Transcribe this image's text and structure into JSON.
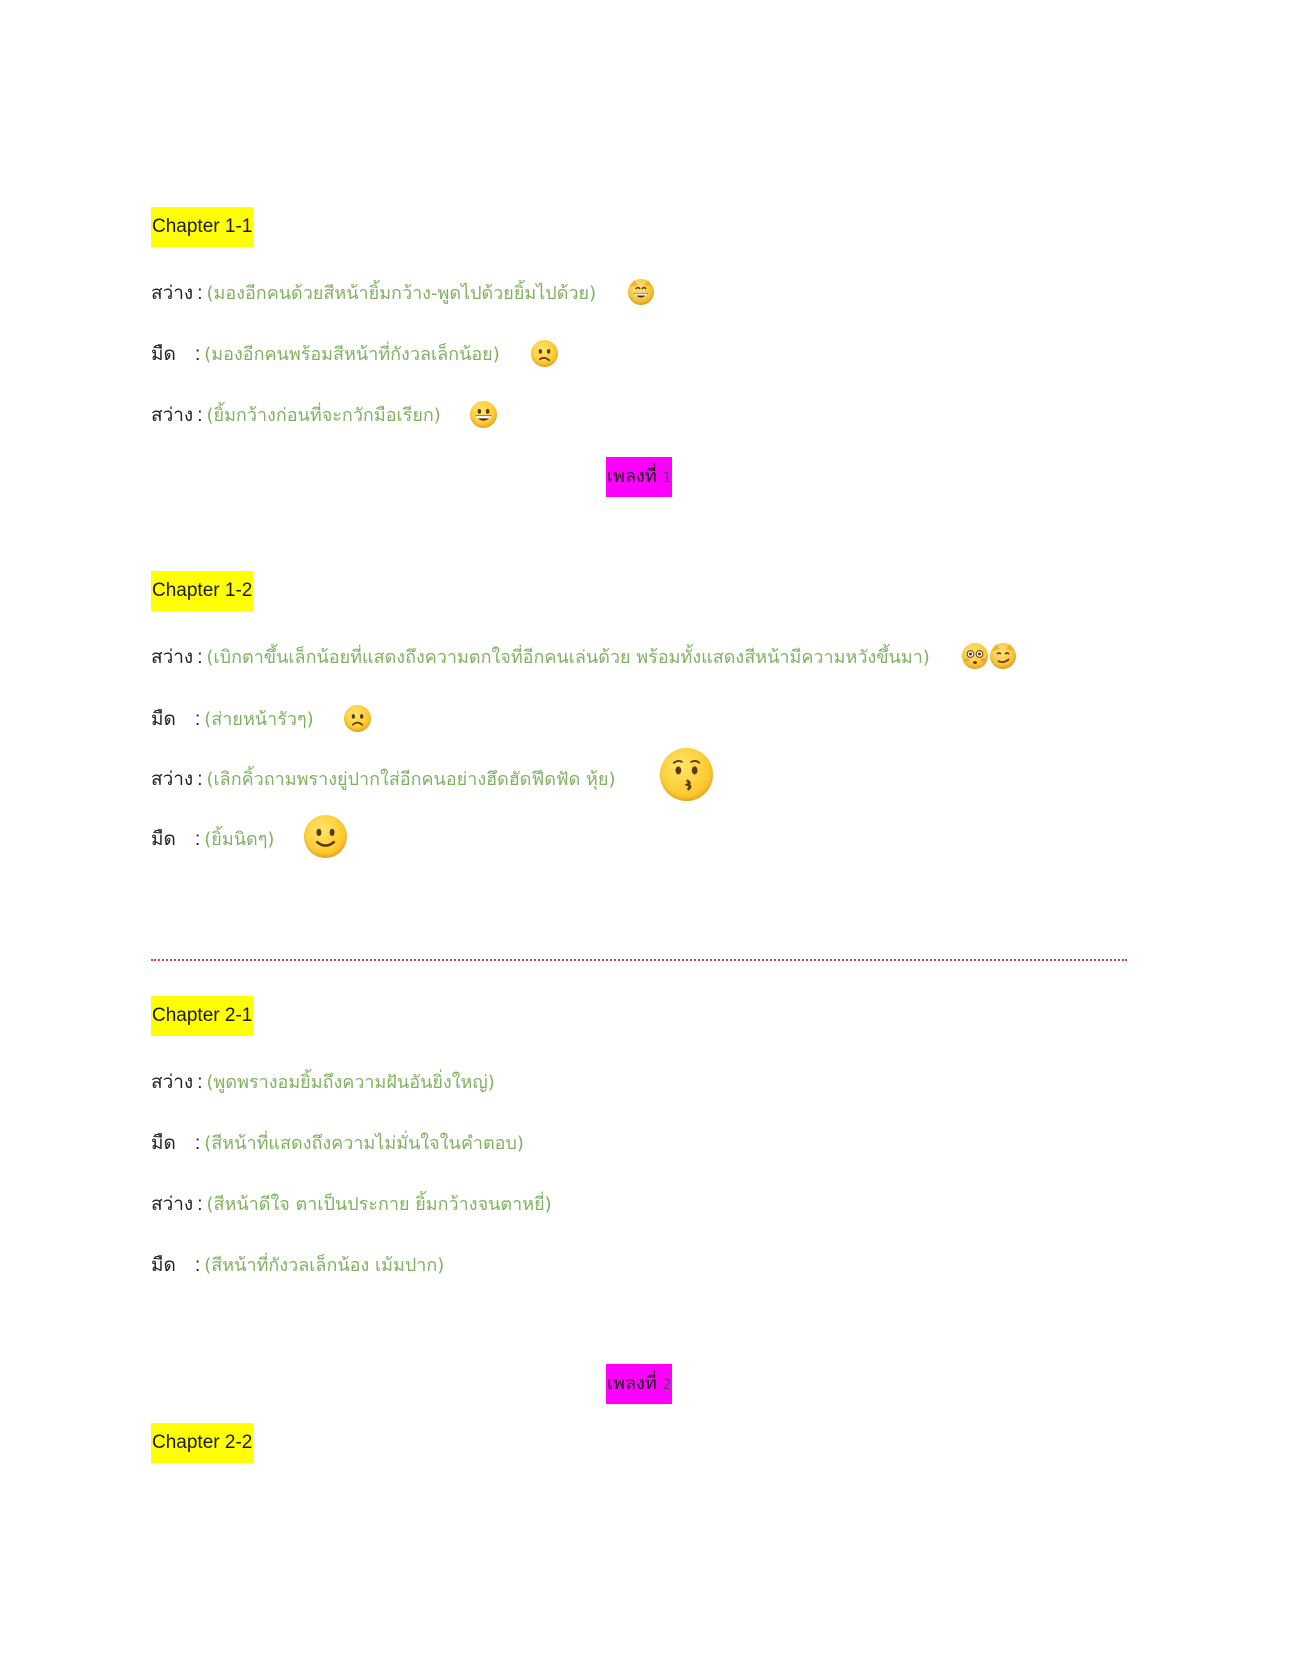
{
  "sections": [
    {
      "heading": "Chapter 1-1",
      "lines": [
        {
          "speaker": "สว่าง",
          "colon": ":",
          "direction": "(มองอีกคนด้วยสีหน้ายิ้มกว้าง-พูดไปด้วยยิ้มไปด้วย)",
          "emoji": "grinning-cat-emoji"
        },
        {
          "speaker": "มืด",
          "colon": ":",
          "direction": "(มองอีกคนพร้อมสีหน้าที่กังวลเล็กน้อย)",
          "emoji": "confused-face-emoji"
        },
        {
          "speaker": "สว่าง",
          "colon": ":",
          "direction": "(ยิ้มกว้างก่อนที่จะกวักมือเรียก)",
          "emoji": "grinning-face-emoji"
        }
      ]
    },
    {
      "heading": "Chapter 1-2",
      "lines": [
        {
          "speaker": "สว่าง",
          "colon": ":",
          "direction": "(เบิกตาขึ้นเล็กน้อยที่แสดงถึงความตกใจที่อีกคนเล่นด้วย พร้อมทั้งแสดงสีหน้ามีความหวังขึ้นมา)",
          "emoji": "flushed-face-and-smirking-cat-emoji"
        },
        {
          "speaker": "มืด",
          "colon": ":",
          "direction": "(ส่ายหน้ารัวๆ)",
          "emoji": "slightly-frowning-face-emoji"
        },
        {
          "speaker": "สว่าง",
          "colon": ":",
          "direction": "(เลิกคิ้วถามพรางยู่ปากใส่อีกคนอย่างฮึดฮัดฟึดฟัด หุ้ย)",
          "emoji": "kissing-face-emoji"
        },
        {
          "speaker": "มืด",
          "colon": ":",
          "direction": "(ยิ้มนิดๆ)",
          "emoji": "slightly-smiling-face-emoji"
        }
      ]
    },
    {
      "heading": "Chapter 2-1",
      "lines": [
        {
          "speaker": "สว่าง",
          "colon": ":",
          "direction": "(พูดพรางอมยิ้มถึงความฝันอันยิ่งใหญ่)"
        },
        {
          "speaker": "มืด",
          "colon": ":",
          "direction": "(สีหน้าที่แสดงถึงความไม่มั่นใจในคำตอบ)"
        },
        {
          "speaker": "สว่าง",
          "colon": ":",
          "direction": "(สีหน้าดีใจ ตาเป็นประกาย ยิ้มกว้างจนตาหยี่)"
        },
        {
          "speaker": "มืด",
          "colon": ":",
          "direction": "(สีหน้าที่กังวลเล็กน้อง เม้มปาก)"
        }
      ]
    },
    {
      "heading": "Chapter 2-2",
      "lines": []
    }
  ],
  "songs": [
    {
      "label": "เพลงที่",
      "number": "1"
    },
    {
      "label": "เพลงที่",
      "number": "2"
    }
  ],
  "colors": {
    "heading_highlight": "#ffff00",
    "song_highlight": "#ff00ff",
    "direction_text": "#7fb15e",
    "divider": "#e23b3b"
  }
}
